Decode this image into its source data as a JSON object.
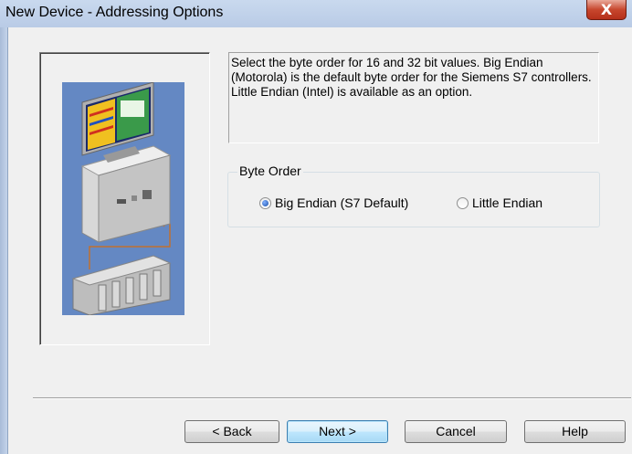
{
  "window": {
    "title": "New Device - Addressing Options",
    "close_symbol": "X"
  },
  "description": "Select the byte order for 16 and 32 bit values.  Big Endian (Motorola) is the default byte order for the Siemens S7 controllers.  Little Endian (Intel) is available as an option.",
  "byte_order": {
    "group_label": "Byte Order",
    "options": [
      {
        "label": "Big Endian (S7 Default)",
        "selected": true
      },
      {
        "label": "Little Endian",
        "selected": false
      }
    ]
  },
  "buttons": {
    "back": "< Back",
    "next": "Next >",
    "cancel": "Cancel",
    "help": "Help"
  },
  "icons": {
    "illustration": "computer-network-plc-illustration",
    "close": "close-icon",
    "radio": "radio-icon"
  }
}
